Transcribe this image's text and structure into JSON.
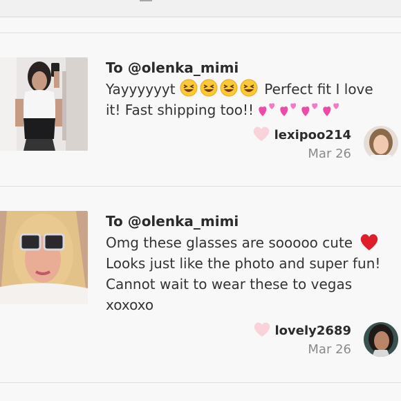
{
  "reviews": [
    {
      "to": "To @olenka_mimi",
      "text_1": "Yayyyyyyt",
      "text_2": "Perfect fit I love",
      "text_3": "it! Fast shipping too!!",
      "author": "lexipoo214",
      "date": "Mar 26",
      "emoji_icon": "grinning-squinting-face-icon",
      "hearts_icon": "two-hearts-icon",
      "like_icon": "heart-outline-icon"
    },
    {
      "to": "To @olenka_mimi",
      "lines": [
        "Omg these glasses are sooooo cute",
        "Looks just like the photo and super fun!",
        "Cannot wait to wear these to vegas",
        "xoxoxo"
      ],
      "author": "lovely2689",
      "date": "Mar 26",
      "heart_icon": "red-heart-icon",
      "like_icon": "heart-outline-icon"
    }
  ],
  "colors": {
    "background": "#f9f8f9",
    "text": "#333333",
    "muted": "#8a8a8a",
    "like_heart": "#f8d3da",
    "red_heart": "#e01d2a"
  }
}
